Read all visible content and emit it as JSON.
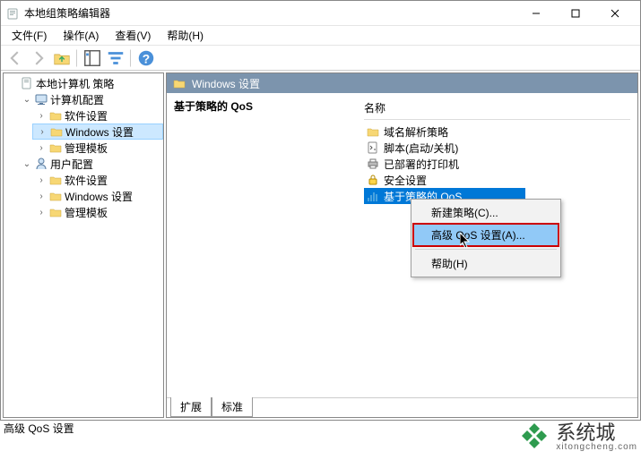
{
  "window": {
    "title": "本地组策略编辑器"
  },
  "menubar": {
    "items": [
      "文件(F)",
      "操作(A)",
      "查看(V)",
      "帮助(H)"
    ]
  },
  "tree": {
    "root": {
      "label": "本地计算机 策略"
    },
    "computer": {
      "label": "计算机配置",
      "children": [
        {
          "label": "软件设置"
        },
        {
          "label": "Windows 设置",
          "selected": true
        },
        {
          "label": "管理模板"
        }
      ]
    },
    "user": {
      "label": "用户配置",
      "children": [
        {
          "label": "软件设置"
        },
        {
          "label": "Windows 设置"
        },
        {
          "label": "管理模板"
        }
      ]
    }
  },
  "rightpane": {
    "header": "Windows 设置",
    "heading": "基于策略的 QoS",
    "col_header": "名称",
    "items": [
      {
        "label": "域名解析策略",
        "icon": "folder"
      },
      {
        "label": "脚本(启动/关机)",
        "icon": "script"
      },
      {
        "label": "已部署的打印机",
        "icon": "printer"
      },
      {
        "label": "安全设置",
        "icon": "lock"
      },
      {
        "label": "基于策略的 QoS",
        "icon": "qos",
        "selected": true
      }
    ],
    "tabs": [
      "扩展",
      "标准"
    ]
  },
  "contextmenu": {
    "items": [
      {
        "label": "新建策略(C)...",
        "type": "item"
      },
      {
        "label": "高级 QoS 设置(A)...",
        "type": "item",
        "highlight": true
      },
      {
        "type": "sep"
      },
      {
        "label": "帮助(H)",
        "type": "item"
      }
    ]
  },
  "statusbar": {
    "text": "高级 QoS 设置"
  },
  "watermark": {
    "brand": "系统城",
    "url": "xitongcheng.com"
  }
}
